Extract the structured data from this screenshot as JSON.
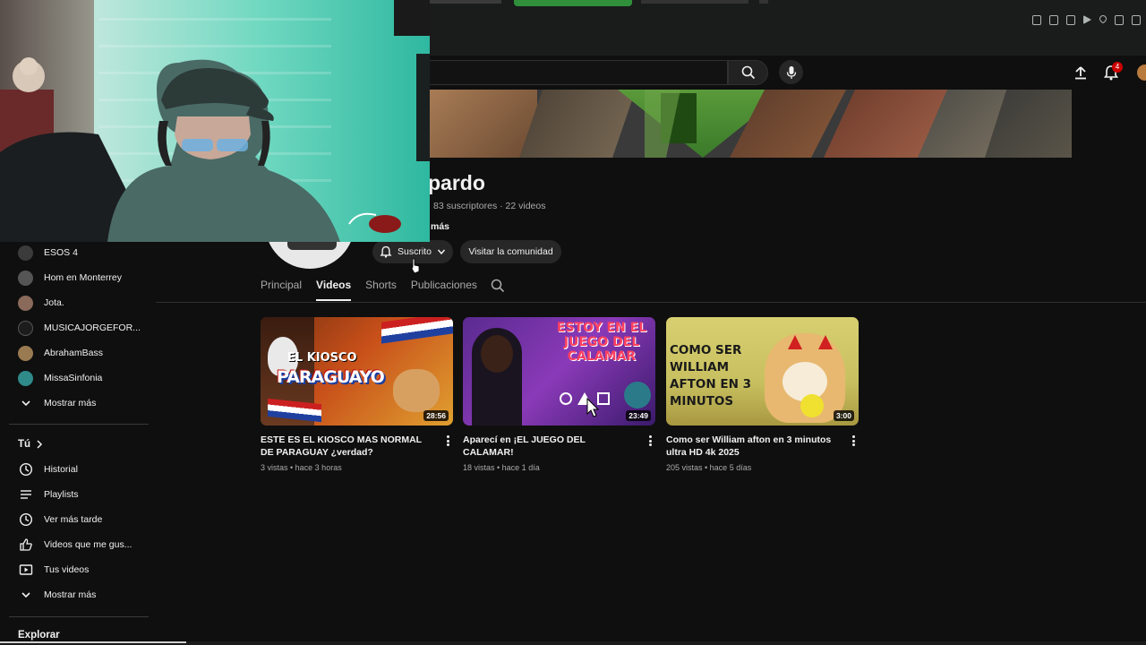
{
  "header": {
    "notifications_count": "4"
  },
  "channel": {
    "name_visible": "pardo",
    "stats": "83 suscriptores · 22 videos",
    "more_label": "más",
    "subscribed_label": "Suscrito",
    "community_label": "Visitar la comunidad"
  },
  "tabs": [
    {
      "label": "Principal",
      "active": false
    },
    {
      "label": "Videos",
      "active": true
    },
    {
      "label": "Shorts",
      "active": false
    },
    {
      "label": "Publicaciones",
      "active": false
    }
  ],
  "videos": [
    {
      "title": "ESTE ES EL KIOSCO MAS NORMAL DE PARAGUAY ¿verdad?",
      "meta": "3 vistas • hace 3 horas",
      "duration": "28:56",
      "thumb_text_top": "EL KIOSCO",
      "thumb_text_main": "PARAGUAYO"
    },
    {
      "title": "Aparecí en ¡EL JUEGO DEL CALAMAR!",
      "meta": "18 vistas • hace 1 día",
      "duration": "23:49",
      "thumb_text_main": "ESTOY EN EL JUEGO DEL CALAMAR"
    },
    {
      "title": "Como ser William afton en 3 minutos ultra HD 4k 2025",
      "meta": "205 vistas • hace 5 días",
      "duration": "3:00",
      "thumb_text_main": "COMO SER WILLIAM AFTON EN 3 MINUTOS"
    }
  ],
  "sidebar": {
    "subscriptions": [
      {
        "label": "ESOS 4",
        "color": "#3b3b3b"
      },
      {
        "label": "Hom en Monterrey",
        "color": "#555"
      },
      {
        "label": "Jota.",
        "color": "#8a6a5a"
      },
      {
        "label": "MUSICAJORGEFOR...",
        "color": "#1c1c1c"
      },
      {
        "label": "AbrahamBass",
        "color": "#9a7a50"
      },
      {
        "label": "MissaSinfonia",
        "color": "#2f8a8a"
      }
    ],
    "show_more_1": "Mostrar más",
    "you_section": "Tú",
    "you_items": [
      {
        "label": "Historial",
        "icon": "history-icon"
      },
      {
        "label": "Playlists",
        "icon": "playlists-icon"
      },
      {
        "label": "Ver más tarde",
        "icon": "watch-later-icon"
      },
      {
        "label": "Videos que me gus...",
        "icon": "like-icon"
      },
      {
        "label": "Tus videos",
        "icon": "your-videos-icon"
      }
    ],
    "show_more_2": "Mostrar más",
    "explore_section": "Explorar"
  }
}
